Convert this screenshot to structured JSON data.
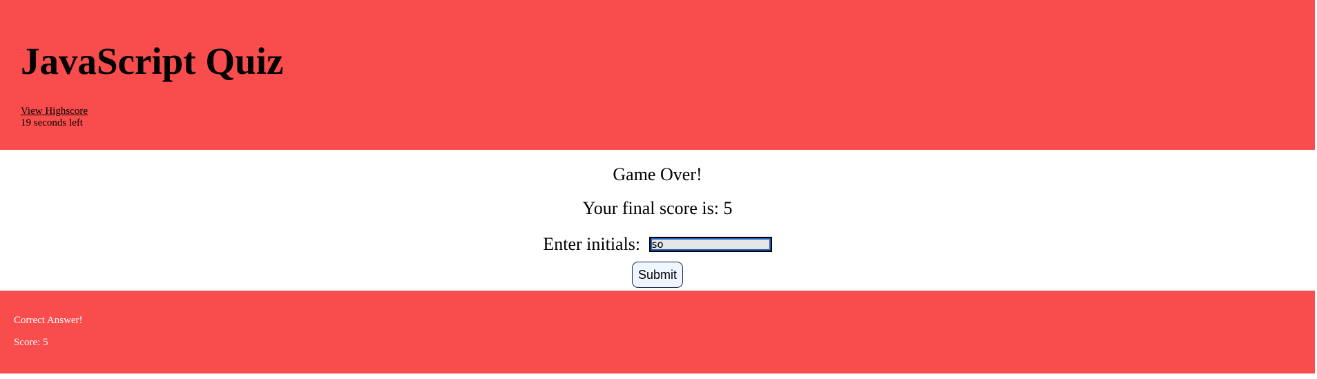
{
  "header": {
    "title": "JavaScript Quiz",
    "highscore_link": "View Highscore",
    "timer": "19 seconds left"
  },
  "main": {
    "game_over": "Game Over!",
    "final_score": "Your final score is: 5",
    "initials_label": "Enter initials:",
    "initials_value": "so",
    "submit_label": "Submit"
  },
  "footer": {
    "feedback": "Correct Answer!",
    "score": "Score: 5"
  },
  "colors": {
    "banner": "#f94c4c",
    "footer_text": "#ffffff",
    "button_background": "#f0f6ff",
    "input_background": "#e6e6e6"
  }
}
